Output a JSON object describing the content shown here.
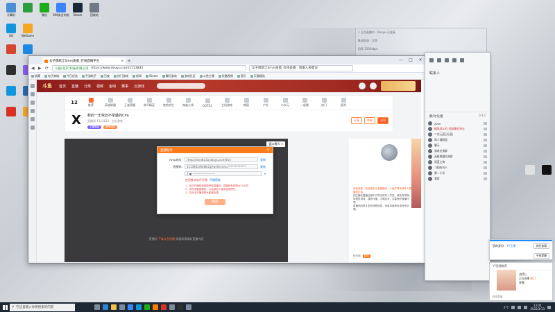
{
  "desktop": {
    "icons": [
      {
        "label": "计算机",
        "color": "#4a8fd6"
      },
      {
        "label": "",
        "color": "#2c9e3b"
      },
      {
        "label": "微信",
        "color": "#1aad19"
      },
      {
        "label": "360安全浏览器",
        "color": "#3a86ff"
      },
      {
        "label": "Steam",
        "color": "#1b2838"
      },
      {
        "label": "回收站",
        "color": "#6f7a86"
      },
      {
        "label": "QQ",
        "color": "#1296db"
      },
      {
        "label": "WeGame",
        "color": "#f5a623"
      },
      {
        "label": "",
        "color": "#d6452f"
      },
      {
        "label": "",
        "color": "#1e88e5"
      },
      {
        "label": "",
        "color": "#2e2e2e"
      },
      {
        "label": "",
        "color": "#8b5cf6"
      },
      {
        "label": "",
        "color": "#1296db"
      },
      {
        "label": "",
        "color": "#2b6cb0"
      },
      {
        "label": "",
        "color": "#d93025"
      },
      {
        "label": "",
        "color": "#f9a825"
      }
    ],
    "right_icons": [
      {
        "label": "",
        "color": "#e0e0e0"
      },
      {
        "label": "",
        "color": "#111111"
      }
    ]
  },
  "browser": {
    "tab_title": "女子偶练江Smm质量_在线直播平台",
    "new_tab": "+",
    "window_controls": [
      "—",
      "□",
      "✕"
    ],
    "nav": [
      "◀",
      "▶",
      "⟳"
    ],
    "url_secure": "斗鱼(北京)科技有限公司",
    "url": "https://www.douyu.com/1113832",
    "search_box": "女子偶练江Smm质量_在线直播 · 请输入关键词",
    "bookmarks": [
      "收藏",
      "电子商城",
      "今日优选",
      "手游助手",
      "百度",
      "热门游戏",
      "新闻",
      "Steam",
      "腾讯游戏",
      "游戏社区",
      "斗鱼主播",
      "优酷视频",
      "音乐",
      "天猫精选"
    ]
  },
  "douyu": {
    "logo": "斗鱼",
    "nav": [
      "首页",
      "直播",
      "分类",
      "视频",
      "鱼吧",
      "赛事",
      "云游戏"
    ],
    "category_count": "12",
    "categories": [
      "推荐",
      "英雄联盟",
      "王者荣耀",
      "和平精英",
      "绝地求生",
      "穿越火线",
      "DOTA2",
      "主机游戏",
      "颜值",
      "户外",
      "二次元",
      "一起看",
      "热门",
      "星秀"
    ],
    "room": {
      "title": "新的一年依旧不举盛的Cifa",
      "subtitle": "直播间 1113832 · 主机游戏",
      "tags": [
        "主播等级",
        "房间活跃"
      ],
      "actions": [
        "分享",
        "举报",
        "关注"
      ]
    },
    "player": {
      "close_label": "窗口模式 ×",
      "hint_prefix": "直播间",
      "hint_link": "下载斗鱼直播",
      "hint_suffix": "观看高清精彩直播内容"
    },
    "side": {
      "chat": [
        {
          "text": "系统消息：欢迎来到斗鱼直播间，斗鱼严禁未成年人直播或打赏。",
          "hl": true
        },
        {
          "text": "如主播在直播过程中引导未成年人打赏，请及时举报。",
          "hl": false
        },
        {
          "text": "请理性消费，谨防诈骗，文明发言，共建良好直播环境。",
          "hl": false
        },
        {
          "text": "直播间内禁止发布违规信息，违者将被禁言或封号处理。",
          "hl": false
        }
      ],
      "bottom": [
        "粉丝团",
        "发送"
      ]
    }
  },
  "dialog": {
    "title": "直播助手",
    "close": "×",
    "rows": [
      {
        "key": "rtmp地址:",
        "value": "rtmp://sendtc3a.douyu.com/live",
        "action": "复制"
      },
      {
        "key": "直播码:",
        "value": "1113832rKeWLGp?wsSecret=*************",
        "action": "复制"
      },
      {
        "key": "",
        "value": "2 ● ————————",
        "action": "▾"
      }
    ],
    "links": [
      "使用推流软件开播",
      "开播帮助"
    ],
    "notes": [
      "1、每次开播前请重新获取直播码，直播码有效期为24小时。",
      "2、请勿泄露直播码，以免被他人盗用造成损失。",
      "3、若无法开播请联系客服处理。"
    ],
    "ok": "确定"
  },
  "qq": {
    "title": "联系人",
    "section": "群/讨论组",
    "section_count": "0/12",
    "contacts": [
      {
        "name": "Zven",
        "red": false
      },
      {
        "name": "精英战斗机_地狱模式突击",
        "red": true
      },
      {
        "name": "二次元夏日乐园",
        "red": false
      },
      {
        "name": "同人漫画组",
        "red": false
      },
      {
        "name": "聊天",
        "red": false
      },
      {
        "name": "游戏交流群",
        "red": false
      },
      {
        "name": "英雄联盟交流群",
        "red": false
      },
      {
        "name": "深蓝之海",
        "red": false
      },
      {
        "name": "飞翔的鸟人",
        "red": false
      },
      {
        "name": "第一小号",
        "red": false
      },
      {
        "name": "我家",
        "red": false
      }
    ]
  },
  "floating_overlay": {
    "lines": [
      "1 正在直播中 · Douyu 已连接",
      "推流状态：正常",
      "码率 2500kbps"
    ]
  },
  "notification": {
    "prefix": "您的身份:",
    "link": "YY主播",
    "button_1": "前往查看",
    "button_2": "不再提醒"
  },
  "promo": {
    "header": "YY直播推荐",
    "line1": "[推荐]",
    "line2_prefix": "正在直播 ",
    "line2_hl": "热门",
    "line3": "直播",
    "footer": "精选直播"
  },
  "taskbar": {
    "search_placeholder": "在这里输入你要搜索的内容",
    "temperature": "4°C",
    "time": "13:04",
    "date": "2022/2/13"
  }
}
